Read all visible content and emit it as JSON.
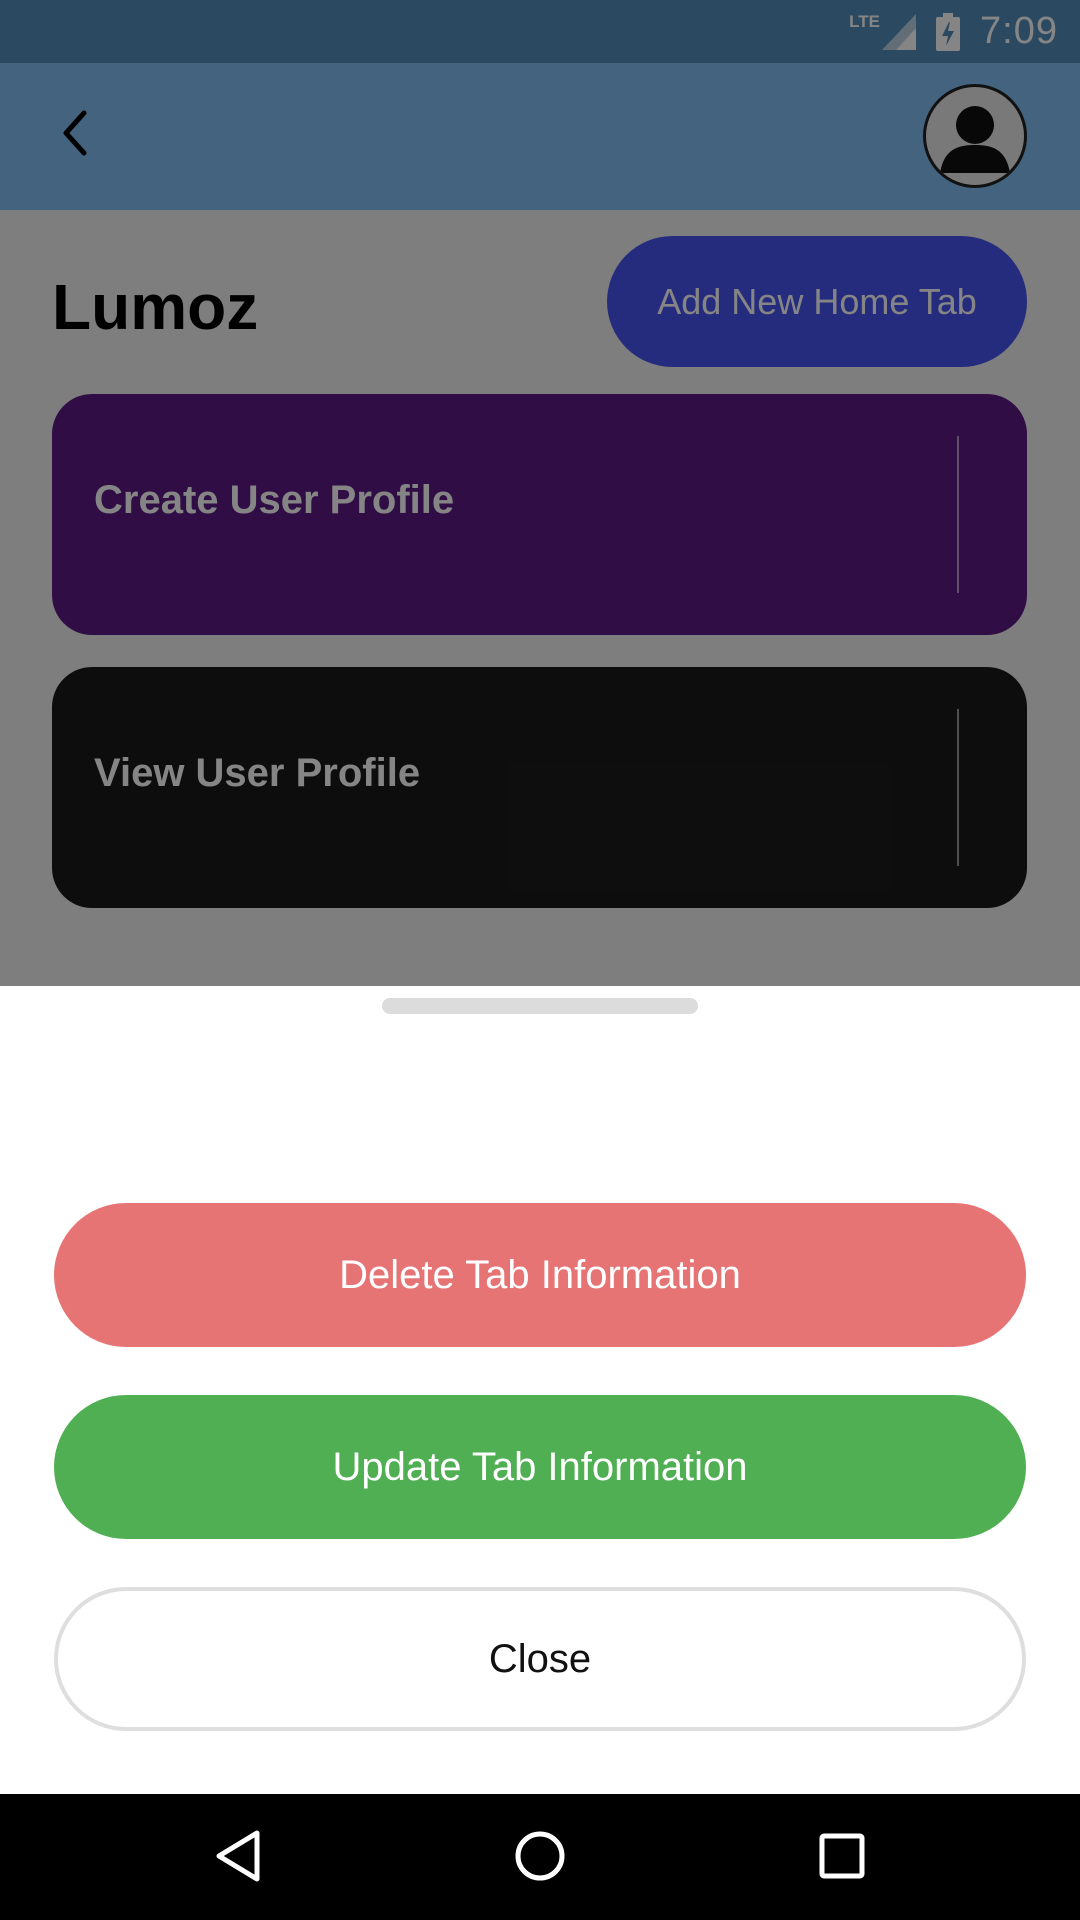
{
  "status_bar": {
    "network": "LTE",
    "time": "7:09",
    "icons": [
      "signal-icon",
      "battery-charging-icon"
    ]
  },
  "app_bar": {
    "back_icon": "chevron-left-icon",
    "avatar_icon": "user-avatar-icon"
  },
  "main": {
    "title": "Lumoz",
    "add_button_label": "Add New Home Tab",
    "tabs": [
      {
        "label": "Create User Profile",
        "color": "#5e1a86"
      },
      {
        "label": "View User Profile",
        "color": "#1a1a1a"
      }
    ]
  },
  "sheet": {
    "delete_label": "Delete Tab Information",
    "update_label": "Update Tab Information",
    "close_label": "Close"
  },
  "nav_bar": {
    "icons": [
      "back-triangle-icon",
      "home-circle-icon",
      "recents-square-icon"
    ]
  },
  "colors": {
    "app_bar": "#80bff3",
    "add_button": "#4a55f0",
    "delete": "#e67474",
    "update": "#4faf52"
  }
}
